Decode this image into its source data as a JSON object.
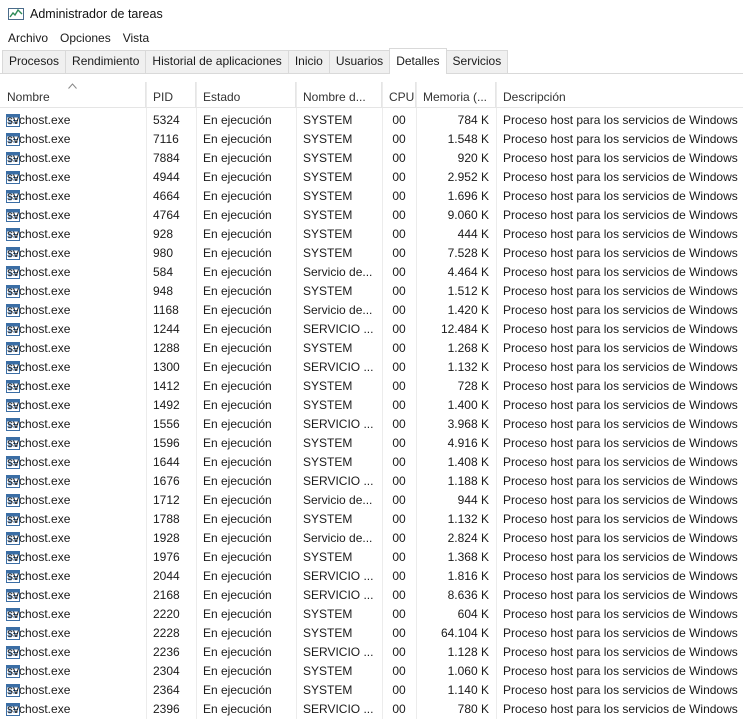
{
  "window": {
    "title": "Administrador de tareas"
  },
  "menu": [
    "Archivo",
    "Opciones",
    "Vista"
  ],
  "tabs": [
    "Procesos",
    "Rendimiento",
    "Historial de aplicaciones",
    "Inicio",
    "Usuarios",
    "Detalles",
    "Servicios"
  ],
  "active_tab": "Detalles",
  "columns": [
    "Nombre",
    "PID",
    "Estado",
    "Nombre d...",
    "CPU",
    "Memoria (...",
    "Descripción"
  ],
  "sort_column": "Nombre",
  "rows": [
    {
      "name": "svchost.exe",
      "pid": "5324",
      "status": "En ejecución",
      "user": "SYSTEM",
      "cpu": "00",
      "mem": "784 K",
      "desc": "Proceso host para los servicios de Windows"
    },
    {
      "name": "svchost.exe",
      "pid": "7116",
      "status": "En ejecución",
      "user": "SYSTEM",
      "cpu": "00",
      "mem": "1.548 K",
      "desc": "Proceso host para los servicios de Windows"
    },
    {
      "name": "svchost.exe",
      "pid": "7884",
      "status": "En ejecución",
      "user": "SYSTEM",
      "cpu": "00",
      "mem": "920 K",
      "desc": "Proceso host para los servicios de Windows"
    },
    {
      "name": "svchost.exe",
      "pid": "4944",
      "status": "En ejecución",
      "user": "SYSTEM",
      "cpu": "00",
      "mem": "2.952 K",
      "desc": "Proceso host para los servicios de Windows"
    },
    {
      "name": "svchost.exe",
      "pid": "4664",
      "status": "En ejecución",
      "user": "SYSTEM",
      "cpu": "00",
      "mem": "1.696 K",
      "desc": "Proceso host para los servicios de Windows"
    },
    {
      "name": "svchost.exe",
      "pid": "4764",
      "status": "En ejecución",
      "user": "SYSTEM",
      "cpu": "00",
      "mem": "9.060 K",
      "desc": "Proceso host para los servicios de Windows"
    },
    {
      "name": "svchost.exe",
      "pid": "928",
      "status": "En ejecución",
      "user": "SYSTEM",
      "cpu": "00",
      "mem": "444 K",
      "desc": "Proceso host para los servicios de Windows"
    },
    {
      "name": "svchost.exe",
      "pid": "980",
      "status": "En ejecución",
      "user": "SYSTEM",
      "cpu": "00",
      "mem": "7.528 K",
      "desc": "Proceso host para los servicios de Windows"
    },
    {
      "name": "svchost.exe",
      "pid": "584",
      "status": "En ejecución",
      "user": "Servicio de...",
      "cpu": "00",
      "mem": "4.464 K",
      "desc": "Proceso host para los servicios de Windows"
    },
    {
      "name": "svchost.exe",
      "pid": "948",
      "status": "En ejecución",
      "user": "SYSTEM",
      "cpu": "00",
      "mem": "1.512 K",
      "desc": "Proceso host para los servicios de Windows"
    },
    {
      "name": "svchost.exe",
      "pid": "1168",
      "status": "En ejecución",
      "user": "Servicio de...",
      "cpu": "00",
      "mem": "1.420 K",
      "desc": "Proceso host para los servicios de Windows"
    },
    {
      "name": "svchost.exe",
      "pid": "1244",
      "status": "En ejecución",
      "user": "SERVICIO ...",
      "cpu": "00",
      "mem": "12.484 K",
      "desc": "Proceso host para los servicios de Windows"
    },
    {
      "name": "svchost.exe",
      "pid": "1288",
      "status": "En ejecución",
      "user": "SYSTEM",
      "cpu": "00",
      "mem": "1.268 K",
      "desc": "Proceso host para los servicios de Windows"
    },
    {
      "name": "svchost.exe",
      "pid": "1300",
      "status": "En ejecución",
      "user": "SERVICIO ...",
      "cpu": "00",
      "mem": "1.132 K",
      "desc": "Proceso host para los servicios de Windows"
    },
    {
      "name": "svchost.exe",
      "pid": "1412",
      "status": "En ejecución",
      "user": "SYSTEM",
      "cpu": "00",
      "mem": "728 K",
      "desc": "Proceso host para los servicios de Windows"
    },
    {
      "name": "svchost.exe",
      "pid": "1492",
      "status": "En ejecución",
      "user": "SYSTEM",
      "cpu": "00",
      "mem": "1.400 K",
      "desc": "Proceso host para los servicios de Windows"
    },
    {
      "name": "svchost.exe",
      "pid": "1556",
      "status": "En ejecución",
      "user": "SERVICIO ...",
      "cpu": "00",
      "mem": "3.968 K",
      "desc": "Proceso host para los servicios de Windows"
    },
    {
      "name": "svchost.exe",
      "pid": "1596",
      "status": "En ejecución",
      "user": "SYSTEM",
      "cpu": "00",
      "mem": "4.916 K",
      "desc": "Proceso host para los servicios de Windows"
    },
    {
      "name": "svchost.exe",
      "pid": "1644",
      "status": "En ejecución",
      "user": "SYSTEM",
      "cpu": "00",
      "mem": "1.408 K",
      "desc": "Proceso host para los servicios de Windows"
    },
    {
      "name": "svchost.exe",
      "pid": "1676",
      "status": "En ejecución",
      "user": "SERVICIO ...",
      "cpu": "00",
      "mem": "1.188 K",
      "desc": "Proceso host para los servicios de Windows"
    },
    {
      "name": "svchost.exe",
      "pid": "1712",
      "status": "En ejecución",
      "user": "Servicio de...",
      "cpu": "00",
      "mem": "944 K",
      "desc": "Proceso host para los servicios de Windows"
    },
    {
      "name": "svchost.exe",
      "pid": "1788",
      "status": "En ejecución",
      "user": "SYSTEM",
      "cpu": "00",
      "mem": "1.132 K",
      "desc": "Proceso host para los servicios de Windows"
    },
    {
      "name": "svchost.exe",
      "pid": "1928",
      "status": "En ejecución",
      "user": "Servicio de...",
      "cpu": "00",
      "mem": "2.824 K",
      "desc": "Proceso host para los servicios de Windows"
    },
    {
      "name": "svchost.exe",
      "pid": "1976",
      "status": "En ejecución",
      "user": "SYSTEM",
      "cpu": "00",
      "mem": "1.368 K",
      "desc": "Proceso host para los servicios de Windows"
    },
    {
      "name": "svchost.exe",
      "pid": "2044",
      "status": "En ejecución",
      "user": "SERVICIO ...",
      "cpu": "00",
      "mem": "1.816 K",
      "desc": "Proceso host para los servicios de Windows"
    },
    {
      "name": "svchost.exe",
      "pid": "2168",
      "status": "En ejecución",
      "user": "SERVICIO ...",
      "cpu": "00",
      "mem": "8.636 K",
      "desc": "Proceso host para los servicios de Windows"
    },
    {
      "name": "svchost.exe",
      "pid": "2220",
      "status": "En ejecución",
      "user": "SYSTEM",
      "cpu": "00",
      "mem": "604 K",
      "desc": "Proceso host para los servicios de Windows"
    },
    {
      "name": "svchost.exe",
      "pid": "2228",
      "status": "En ejecución",
      "user": "SYSTEM",
      "cpu": "00",
      "mem": "64.104 K",
      "desc": "Proceso host para los servicios de Windows"
    },
    {
      "name": "svchost.exe",
      "pid": "2236",
      "status": "En ejecución",
      "user": "SERVICIO ...",
      "cpu": "00",
      "mem": "1.128 K",
      "desc": "Proceso host para los servicios de Windows"
    },
    {
      "name": "svchost.exe",
      "pid": "2304",
      "status": "En ejecución",
      "user": "SYSTEM",
      "cpu": "00",
      "mem": "1.060 K",
      "desc": "Proceso host para los servicios de Windows"
    },
    {
      "name": "svchost.exe",
      "pid": "2364",
      "status": "En ejecución",
      "user": "SYSTEM",
      "cpu": "00",
      "mem": "1.140 K",
      "desc": "Proceso host para los servicios de Windows"
    },
    {
      "name": "svchost.exe",
      "pid": "2396",
      "status": "En ejecución",
      "user": "SERVICIO ...",
      "cpu": "00",
      "mem": "780 K",
      "desc": "Proceso host para los servicios de Windows"
    }
  ]
}
